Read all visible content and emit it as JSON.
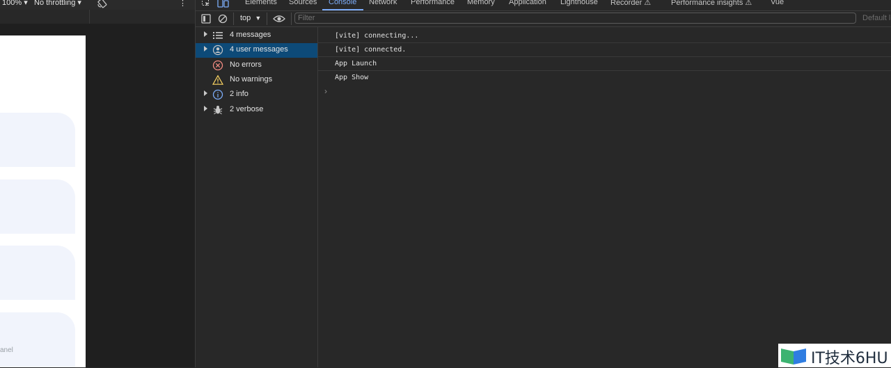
{
  "left_toolbar": {
    "zoom": "100%",
    "throttling": "No throttling",
    "caret": "▾",
    "menu_glyph": "⋮",
    "phone_caption": "anel"
  },
  "devtools": {
    "tabs": [
      {
        "label": "Elements",
        "active": false
      },
      {
        "label": "Sources",
        "active": false
      },
      {
        "label": "Console",
        "active": true
      },
      {
        "label": "Network",
        "active": false
      },
      {
        "label": "Performance",
        "active": false
      },
      {
        "label": "Memory",
        "active": false
      },
      {
        "label": "Application",
        "active": false
      },
      {
        "label": "Lighthouse",
        "active": false
      },
      {
        "label": "Recorder ⚠",
        "active": false
      },
      {
        "label": "Performance insights ⚠",
        "active": false
      },
      {
        "label": "Vue",
        "active": false
      }
    ],
    "accent_color": "#7cacf8"
  },
  "console_toolbar": {
    "context": "top",
    "filter_placeholder": "Filter",
    "default_levels": "Default levels"
  },
  "sidebar": {
    "items": [
      {
        "label": "4 messages",
        "icon": "list-icon",
        "expandable": true,
        "selected": false
      },
      {
        "label": "4 user messages",
        "icon": "user-icon",
        "expandable": true,
        "selected": true
      },
      {
        "label": "No errors",
        "icon": "error-icon",
        "expandable": false,
        "selected": false
      },
      {
        "label": "No warnings",
        "icon": "warning-icon",
        "expandable": false,
        "selected": false
      },
      {
        "label": "2 info",
        "icon": "info-icon",
        "expandable": true,
        "selected": false
      },
      {
        "label": "2 verbose",
        "icon": "bug-icon",
        "expandable": true,
        "selected": false
      }
    ],
    "selected_color": "#0d4a78"
  },
  "messages": [
    "[vite] connecting...",
    "[vite] connected.",
    "App Launch",
    "App Show"
  ],
  "prompt_glyph": "›",
  "watermark": {
    "text": "IT技术6HU"
  }
}
